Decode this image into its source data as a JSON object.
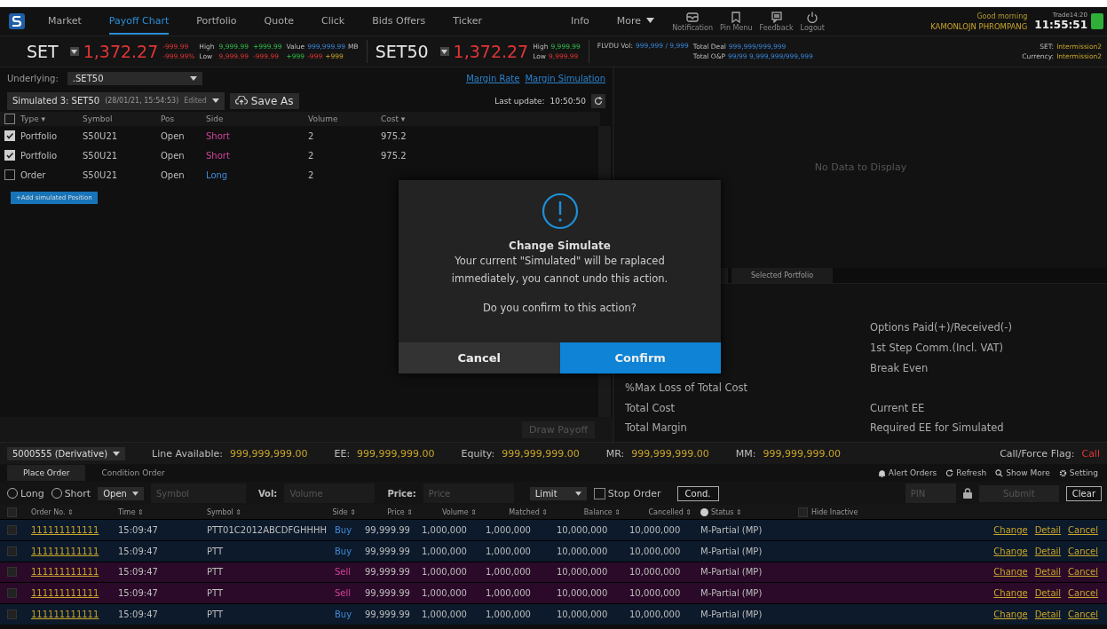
{
  "nav": {
    "tabs": [
      {
        "label": "Market",
        "selected": false
      },
      {
        "label": "Payoff Chart",
        "selected": true
      },
      {
        "label": "Portfolio",
        "selected": false
      },
      {
        "label": "Quote",
        "selected": false
      },
      {
        "label": "Click",
        "selected": false
      },
      {
        "label": "Bids Offers",
        "selected": false
      },
      {
        "label": "Ticker",
        "selected": false
      },
      {
        "label": "Info",
        "selected": false
      }
    ],
    "more": "More",
    "tools": [
      {
        "label": "Notification",
        "kind": "mail"
      },
      {
        "label": "Pin Menu",
        "kind": "bookmark"
      },
      {
        "label": "Feedback",
        "kind": "chat"
      },
      {
        "label": "Logout",
        "kind": "power"
      }
    ],
    "greeting": "Good morning",
    "user": "KAMONLOJN PHROMPANG",
    "session": "Trade14:20",
    "clock": "11:55:51"
  },
  "ticker": {
    "set": {
      "name": "SET",
      "last": "1,372.27",
      "change": "-999.99",
      "percent": "-999.99%",
      "high_label": "High",
      "high": "9,999.99",
      "high_change": "+999.99",
      "low_label": "Low",
      "low": "9,999.99",
      "low_change": "-999.99",
      "value_label": "Value",
      "value": "999,999.99",
      "value_unit": "MB",
      "up": "+999",
      "down": "-999",
      "unchanged": "+999"
    },
    "set50": {
      "name": "SET50",
      "last": "1,372.27",
      "high_label": "High",
      "high": "9,999.99",
      "low_label": "Low",
      "low": "9,999.99"
    },
    "flvdu": {
      "label": "FLVDU Vol:",
      "value": "999,999 / 9,999"
    },
    "total_deal": {
      "label": "Total Deal",
      "value": "999,999/999,999"
    },
    "total_op": {
      "label": "Total O&P",
      "value": "99/99 9,999,999/999,999"
    },
    "market": [
      {
        "label": "SET:",
        "value": "Intermission2"
      },
      {
        "label": "Currency:",
        "value": "Intermission2"
      }
    ]
  },
  "simulator": {
    "underlying_label": "Underlying:",
    "underlying": ".SET50",
    "links": [
      "Margin Rate",
      "Margin Simulation"
    ],
    "simulation": "Simulated 3: SET50",
    "simulation_time": "(28/01/21, 15:54:53)",
    "simulation_tag": "Edited",
    "save_as": "Save As",
    "last_update_label": "Last update:",
    "last_update": "10:50:50",
    "select_all": {
      "checked": false
    },
    "columns": [
      "Type ▾",
      "Symbol",
      "Pos",
      "Side",
      "Volume",
      "Cost ▾"
    ],
    "rows": [
      {
        "checked": true,
        "type": "Portfolio",
        "symbol": "S50U21",
        "pos": "Open",
        "side": "Short",
        "kind": "short",
        "volume": "2",
        "cost": "975.2"
      },
      {
        "checked": true,
        "type": "Portfolio",
        "symbol": "S50U21",
        "pos": "Open",
        "side": "Short",
        "kind": "short",
        "volume": "2",
        "cost": "975.2"
      },
      {
        "checked": false,
        "type": "Order",
        "symbol": "S50U21",
        "pos": "Open",
        "side": "Long",
        "kind": "long",
        "volume": "2"
      }
    ],
    "add_button": "+Add simulated Position",
    "draw_button": "Draw Payoff"
  },
  "payoff": {
    "empty": "No Data to Display",
    "tabs": [
      {
        "label": "Selected Portfolio",
        "selected": false
      }
    ],
    "stats": [
      {
        "right": "Options Paid(+)/Received(-)"
      },
      {
        "right": "1st Step Comm.(Incl. VAT)"
      },
      {
        "right": "Break Even"
      },
      {
        "left": "%Max Loss of Total Cost"
      },
      {
        "left": "Total Cost",
        "right": "Current EE"
      },
      {
        "left": "Total Margin",
        "right": "Required EE for Simulated"
      }
    ]
  },
  "dialog": {
    "title": "Change Simulate",
    "message": "Your current \"Simulated\" will be raplaced immediately, you cannot undo this action.",
    "question": "Do you confirm to this action?",
    "cancel": "Cancel",
    "confirm": "Confirm"
  },
  "account": {
    "name": "5000555 (Derivative)",
    "fields": [
      {
        "label": "Line Available:",
        "value": "999,999,999.00"
      },
      {
        "label": "EE:",
        "value": "999,999,999.00"
      },
      {
        "label": "Equity:",
        "value": "999,999,999.00"
      },
      {
        "label": "MR:",
        "value": "999,999,999.00"
      },
      {
        "label": "MM:",
        "value": "999,999,999.00"
      }
    ],
    "flag_label": "Call/Force Flag:",
    "flag": "Call"
  },
  "order_tabs": [
    {
      "label": "Place Order",
      "selected": true
    },
    {
      "label": "Condition Order",
      "selected": false
    }
  ],
  "order_actions": [
    {
      "label": "Alert Orders",
      "kind": "bell"
    },
    {
      "label": "Refresh",
      "kind": "refresh"
    },
    {
      "label": "Show More",
      "kind": "search"
    },
    {
      "label": "Setting",
      "kind": "gear"
    }
  ],
  "order_entry": {
    "long": {
      "label": "Long",
      "selected": false
    },
    "short": {
      "label": "Short",
      "selected": false
    },
    "position": "Open",
    "symbol_placeholder": "Symbol",
    "vol_label": "Vol:",
    "vol_placeholder": "Volume",
    "price_label": "Price:",
    "price_placeholder": "Price",
    "price_type": "Limit",
    "stop_order": {
      "label": "Stop Order",
      "checked": false
    },
    "cond": "Cond.",
    "pin_placeholder": "PIN",
    "submit": "Submit",
    "clear": "Clear"
  },
  "orders": {
    "columns": [
      "Order No. ⇕",
      "Time ⇕",
      "Symbol ⇕",
      "Side ⇕",
      "Price ⇕",
      "Volume ⇕",
      "Matched ⇕",
      "Balance ⇕",
      "Cancelled ⇕",
      "Status ⇕"
    ],
    "select_all": {
      "checked": false
    },
    "hide_inactive": {
      "label": "Hide Inactive",
      "checked": false
    },
    "rows": [
      {
        "checked": false,
        "order_no": "111111111111",
        "time": "15:09:47",
        "symbol": "PTT01C2012ABCDFGHHHH",
        "side": "Buy",
        "kind": "buy",
        "price": "99,999.99",
        "volume": "1,000,000",
        "matched": "1,000,000",
        "balance": "10,000,000",
        "cancelled": "10,000,000",
        "status": "M-Partial (MP)",
        "actions": [
          "Change",
          "Detail",
          "Cancel"
        ]
      },
      {
        "checked": false,
        "order_no": "111111111111",
        "time": "15:09:47",
        "symbol": "PTT",
        "side": "Buy",
        "kind": "buy",
        "price": "99,999.99",
        "volume": "1,000,000",
        "matched": "1,000,000",
        "balance": "10,000,000",
        "cancelled": "10,000,000",
        "status": "M-Partial (MP)",
        "actions": [
          "Change",
          "Detail",
          "Cancel"
        ]
      },
      {
        "checked": false,
        "order_no": "111111111111",
        "time": "15:09:47",
        "symbol": "PTT",
        "side": "Sell",
        "kind": "sell",
        "price": "99,999.99",
        "volume": "1,000,000",
        "matched": "1,000,000",
        "balance": "10,000,000",
        "cancelled": "10,000,000",
        "status": "M-Partial (MP)",
        "actions": [
          "Change",
          "Detail",
          "Cancel"
        ]
      },
      {
        "checked": false,
        "order_no": "111111111111",
        "time": "15:09:47",
        "symbol": "PTT",
        "side": "Sell",
        "kind": "sell",
        "price": "99,999.99",
        "volume": "1,000,000",
        "matched": "1,000,000",
        "balance": "10,000,000",
        "cancelled": "10,000,000",
        "status": "M-Partial (MP)",
        "actions": [
          "Change",
          "Detail",
          "Cancel"
        ]
      },
      {
        "checked": false,
        "order_no": "111111111111",
        "time": "15:09:47",
        "symbol": "PTT",
        "side": "Buy",
        "kind": "buy",
        "price": "99,999.99",
        "volume": "1,000,000",
        "matched": "1,000,000",
        "balance": "10,000,000",
        "cancelled": "10,000,000",
        "status": "M-Partial (MP)",
        "actions": [
          "Change",
          "Detail",
          "Cancel"
        ]
      }
    ]
  }
}
